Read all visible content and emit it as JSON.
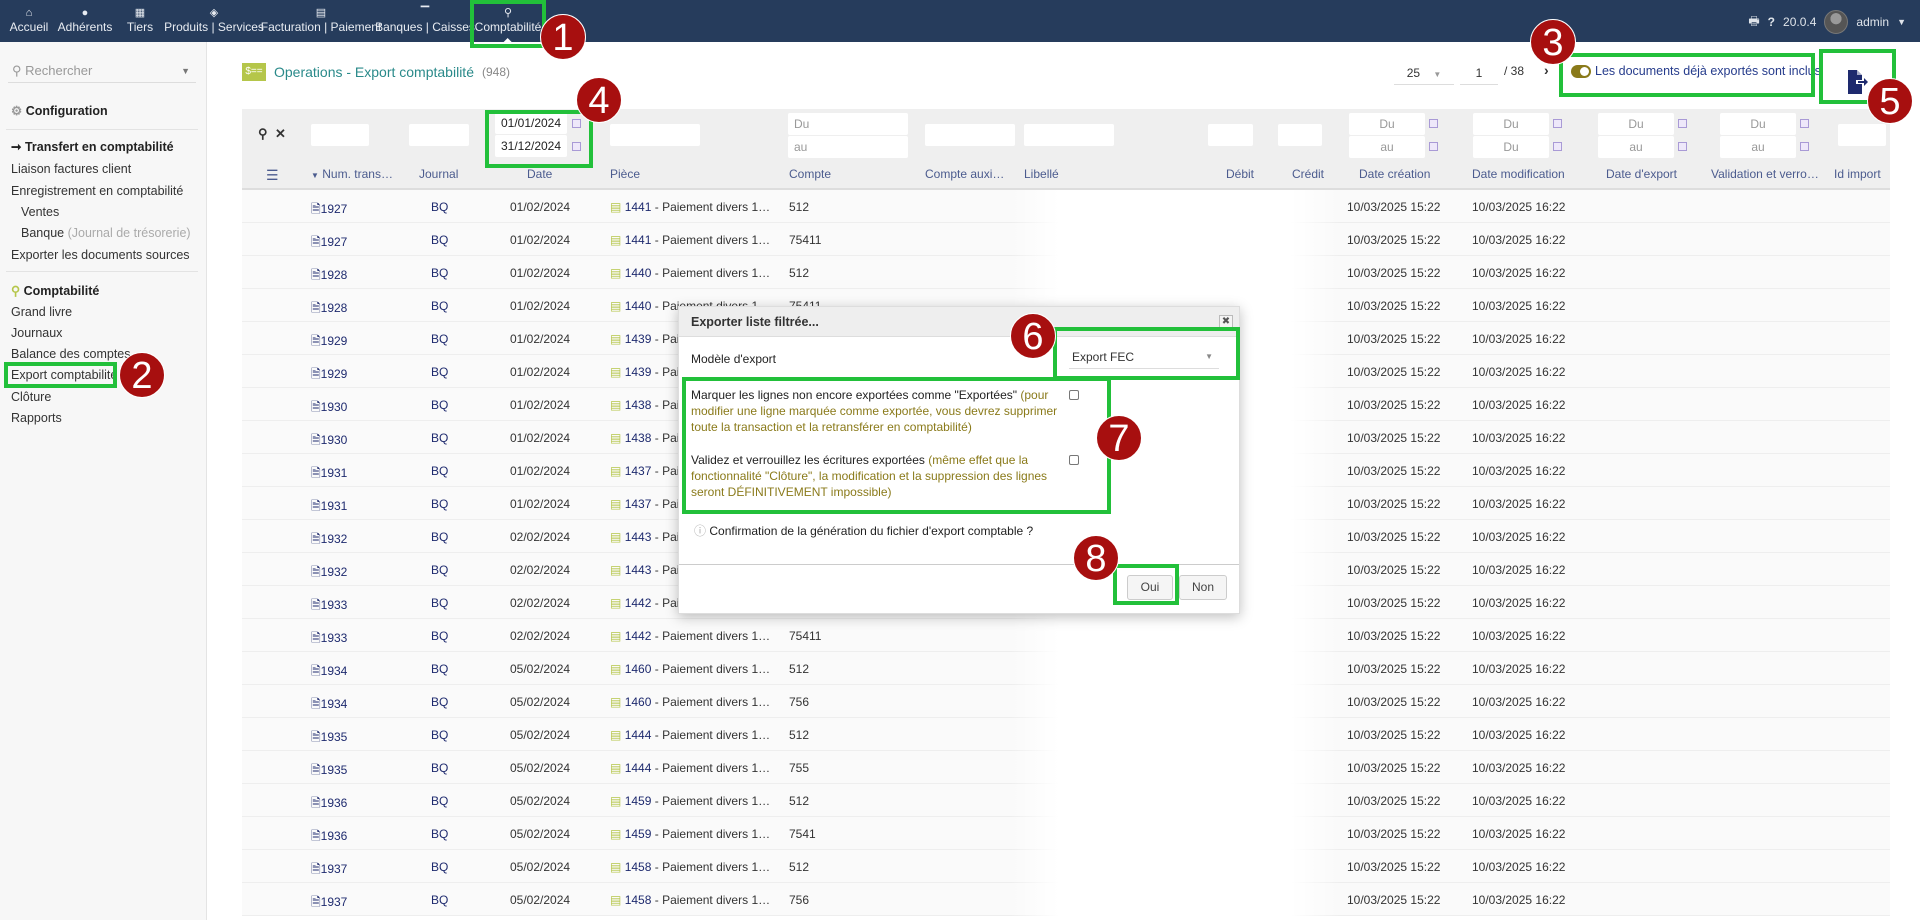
{
  "nav": {
    "items": [
      {
        "label": "Accueil",
        "icon": "home-icon"
      },
      {
        "label": "Adhérents",
        "icon": "user-icon"
      },
      {
        "label": "Tiers",
        "icon": "building-icon"
      },
      {
        "label": "Produits | Services",
        "icon": "cube-icon"
      },
      {
        "label": "Facturation | Paiement",
        "icon": "invoice-icon"
      },
      {
        "label": "Banques | Caisses",
        "icon": "bank-icon"
      },
      {
        "label": "Comptabilité",
        "icon": "search-dollar-icon"
      }
    ],
    "version": "20.0.4",
    "user": "admin"
  },
  "sidebar": {
    "search_placeholder": "Rechercher",
    "config": "Configuration",
    "transfer_title": "Transfert en comptabilité",
    "liaison": "Liaison factures client",
    "enregistrement": "Enregistrement en comptabilité",
    "ventes": "Ventes",
    "banque": "Banque",
    "banque_note": "(Journal de trésorerie)",
    "exporter_docs": "Exporter les documents sources",
    "compta_title": "Comptabilité",
    "grand_livre": "Grand livre",
    "journaux": "Journaux",
    "balance": "Balance des comptes",
    "export": "Export comptabilité",
    "cloture": "Clôture",
    "rapports": "Rapports"
  },
  "page": {
    "title": "Operations - Export comptabilité",
    "count": "(948)",
    "per_page": "25",
    "page": "1",
    "total_pages": "/ 38",
    "toggle_label": "Les documents déjà exportés sont inclus",
    "accent": "#2a8a8a"
  },
  "filters": {
    "date_from": "01/01/2024",
    "date_to": "31/12/2024",
    "du": "Du",
    "au": "au"
  },
  "columns": [
    "Num. trans…",
    "Journal",
    "Date",
    "Pièce",
    "Compte",
    "Compte auxi…",
    "Libellé",
    "Débit",
    "Crédit",
    "Date création",
    "Date modification",
    "Date d'export",
    "Validation et verro…",
    "Id import"
  ],
  "rows": [
    {
      "num": "1927",
      "journal": "BQ",
      "date": "01/02/2024",
      "piece": "1441",
      "piece_label": "- Paiement divers 1…",
      "compte": "512",
      "created": "10/03/2025 15:22",
      "modified": "10/03/2025 16:22"
    },
    {
      "num": "1927",
      "journal": "BQ",
      "date": "01/02/2024",
      "piece": "1441",
      "piece_label": "- Paiement divers 1…",
      "compte": "75411",
      "created": "10/03/2025 15:22",
      "modified": "10/03/2025 16:22"
    },
    {
      "num": "1928",
      "journal": "BQ",
      "date": "01/02/2024",
      "piece": "1440",
      "piece_label": "- Paiement divers 1…",
      "compte": "512",
      "created": "10/03/2025 15:22",
      "modified": "10/03/2025 16:22"
    },
    {
      "num": "1928",
      "journal": "BQ",
      "date": "01/02/2024",
      "piece": "1440",
      "piece_label": "- Paiement divers 1…",
      "compte": "75411",
      "created": "10/03/2025 15:22",
      "modified": "10/03/2025 16:22"
    },
    {
      "num": "1929",
      "journal": "BQ",
      "date": "01/02/2024",
      "piece": "1439",
      "piece_label": "- Pai",
      "compte": "",
      "created": "10/03/2025 15:22",
      "modified": "10/03/2025 16:22"
    },
    {
      "num": "1929",
      "journal": "BQ",
      "date": "01/02/2024",
      "piece": "1439",
      "piece_label": "- Pai",
      "compte": "",
      "created": "10/03/2025 15:22",
      "modified": "10/03/2025 16:22"
    },
    {
      "num": "1930",
      "journal": "BQ",
      "date": "01/02/2024",
      "piece": "1438",
      "piece_label": "- Pai",
      "compte": "",
      "created": "10/03/2025 15:22",
      "modified": "10/03/2025 16:22"
    },
    {
      "num": "1930",
      "journal": "BQ",
      "date": "01/02/2024",
      "piece": "1438",
      "piece_label": "- Pai",
      "compte": "",
      "created": "10/03/2025 15:22",
      "modified": "10/03/2025 16:22"
    },
    {
      "num": "1931",
      "journal": "BQ",
      "date": "01/02/2024",
      "piece": "1437",
      "piece_label": "- Pai",
      "compte": "",
      "created": "10/03/2025 15:22",
      "modified": "10/03/2025 16:22"
    },
    {
      "num": "1931",
      "journal": "BQ",
      "date": "01/02/2024",
      "piece": "1437",
      "piece_label": "- Pai",
      "compte": "",
      "created": "10/03/2025 15:22",
      "modified": "10/03/2025 16:22"
    },
    {
      "num": "1932",
      "journal": "BQ",
      "date": "02/02/2024",
      "piece": "1443",
      "piece_label": "- Pai",
      "compte": "",
      "created": "10/03/2025 15:22",
      "modified": "10/03/2025 16:22"
    },
    {
      "num": "1932",
      "journal": "BQ",
      "date": "02/02/2024",
      "piece": "1443",
      "piece_label": "- Pai",
      "compte": "",
      "created": "10/03/2025 15:22",
      "modified": "10/03/2025 16:22"
    },
    {
      "num": "1933",
      "journal": "BQ",
      "date": "02/02/2024",
      "piece": "1442",
      "piece_label": "- Pai",
      "compte": "",
      "created": "10/03/2025 15:22",
      "modified": "10/03/2025 16:22"
    },
    {
      "num": "1933",
      "journal": "BQ",
      "date": "02/02/2024",
      "piece": "1442",
      "piece_label": "- Paiement divers 1…",
      "compte": "75411",
      "created": "10/03/2025 15:22",
      "modified": "10/03/2025 16:22"
    },
    {
      "num": "1934",
      "journal": "BQ",
      "date": "05/02/2024",
      "piece": "1460",
      "piece_label": "- Paiement divers 1…",
      "compte": "512",
      "created": "10/03/2025 15:22",
      "modified": "10/03/2025 16:22"
    },
    {
      "num": "1934",
      "journal": "BQ",
      "date": "05/02/2024",
      "piece": "1460",
      "piece_label": "- Paiement divers 1…",
      "compte": "756",
      "created": "10/03/2025 15:22",
      "modified": "10/03/2025 16:22"
    },
    {
      "num": "1935",
      "journal": "BQ",
      "date": "05/02/2024",
      "piece": "1444",
      "piece_label": "- Paiement divers 1…",
      "compte": "512",
      "created": "10/03/2025 15:22",
      "modified": "10/03/2025 16:22"
    },
    {
      "num": "1935",
      "journal": "BQ",
      "date": "05/02/2024",
      "piece": "1444",
      "piece_label": "- Paiement divers 1…",
      "compte": "755",
      "created": "10/03/2025 15:22",
      "modified": "10/03/2025 16:22"
    },
    {
      "num": "1936",
      "journal": "BQ",
      "date": "05/02/2024",
      "piece": "1459",
      "piece_label": "- Paiement divers 1…",
      "compte": "512",
      "created": "10/03/2025 15:22",
      "modified": "10/03/2025 16:22"
    },
    {
      "num": "1936",
      "journal": "BQ",
      "date": "05/02/2024",
      "piece": "1459",
      "piece_label": "- Paiement divers 1…",
      "compte": "7541",
      "created": "10/03/2025 15:22",
      "modified": "10/03/2025 16:22"
    },
    {
      "num": "1937",
      "journal": "BQ",
      "date": "05/02/2024",
      "piece": "1458",
      "piece_label": "- Paiement divers 1…",
      "compte": "512",
      "created": "10/03/2025 15:22",
      "modified": "10/03/2025 16:22"
    },
    {
      "num": "1937",
      "journal": "BQ",
      "date": "05/02/2024",
      "piece": "1458",
      "piece_label": "- Paiement divers 1…",
      "compte": "756",
      "created": "10/03/2025 15:22",
      "modified": "10/03/2025 16:22"
    }
  ],
  "modal": {
    "title": "Exporter liste filtrée...",
    "model_label": "Modèle d'export",
    "model_value": "Export FEC",
    "mark_text": "Marquer les lignes non encore exportées comme \"Exportées\"",
    "mark_note": "(pour modifier une ligne marquée comme exportée, vous devrez supprimer toute la transaction et la retransférer en comptabilité)",
    "validate_text": "Validez et verrouillez les écritures exportées",
    "validate_note": "(même effet que la fonctionnalité \"Clôture\", la modification et la suppression des lignes seront DÉFINITIVEMENT impossible)",
    "confirm": "Confirmation de la génération du fichier d'export comptable ?",
    "yes": "Oui",
    "no": "Non"
  },
  "annotations": [
    "1",
    "2",
    "3",
    "4",
    "5",
    "6",
    "7",
    "8"
  ]
}
